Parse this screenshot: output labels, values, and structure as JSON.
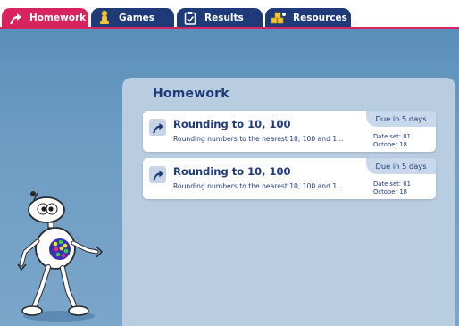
{
  "tabs": [
    {
      "label": "Homework",
      "icon": "homework-icon",
      "active": true
    },
    {
      "label": "Games",
      "icon": "games-icon",
      "active": false
    },
    {
      "label": "Results",
      "icon": "results-icon",
      "active": false
    },
    {
      "label": "Resources",
      "icon": "resources-icon",
      "active": false
    }
  ],
  "panel": {
    "title": "Homework",
    "items": [
      {
        "title": "Rounding to 10, 100",
        "description": "Rounding numbers to the nearest 10, 100 and 1...",
        "due": "Due in 5 days",
        "date_set_line1": "Date set: 01",
        "date_set_line2": "October 18"
      },
      {
        "title": "Rounding to 10, 100",
        "description": "Rounding numbers to the nearest 10, 100 and 1...",
        "due": "Due in 5 days",
        "date_set_line1": "Date set: 01",
        "date_set_line2": "October 18"
      }
    ]
  },
  "colors": {
    "accent": "#d8245e",
    "tab_bg": "#1f3a78",
    "text": "#1f3a78",
    "panel_bg": "#b8cde0"
  }
}
